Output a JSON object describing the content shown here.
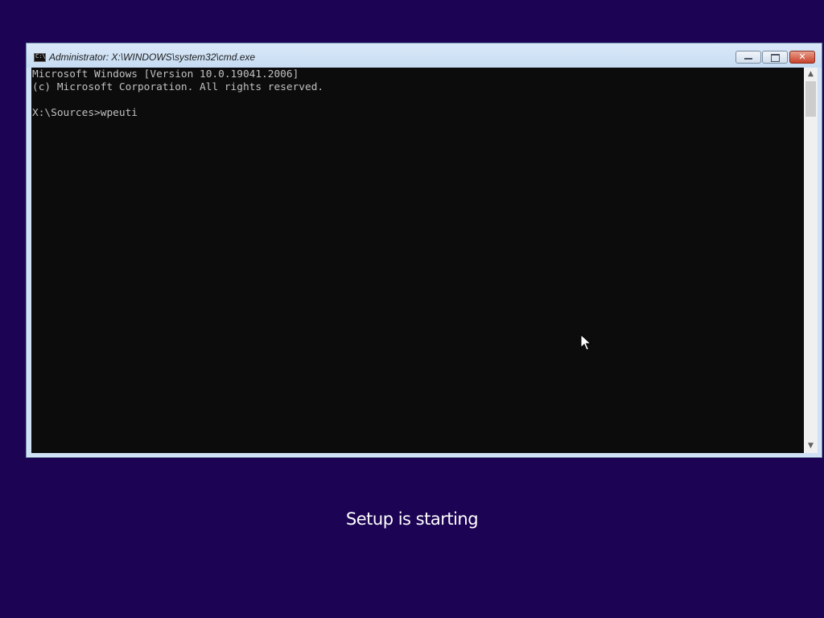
{
  "window": {
    "title": "Administrator: X:\\WINDOWS\\system32\\cmd.exe",
    "icon": "cmd-icon",
    "buttons": {
      "minimize_icon": "minimize-icon",
      "maximize_icon": "maximize-icon",
      "close_icon": "close-icon",
      "close_glyph": "✕"
    }
  },
  "console": {
    "lines": [
      "Microsoft Windows [Version 10.0.19041.2006]",
      "(c) Microsoft Corporation. All rights reserved.",
      "",
      "X:\\Sources>wpeuti"
    ],
    "background_color": "#0c0c0c",
    "text_color": "#c0c0c0"
  },
  "scrollbar": {
    "up_arrow": "▲",
    "down_arrow": "▼"
  },
  "setup": {
    "status": "Setup is starting"
  },
  "colors": {
    "desktop_background": "#1c0354",
    "close_button": "#c7412b"
  }
}
